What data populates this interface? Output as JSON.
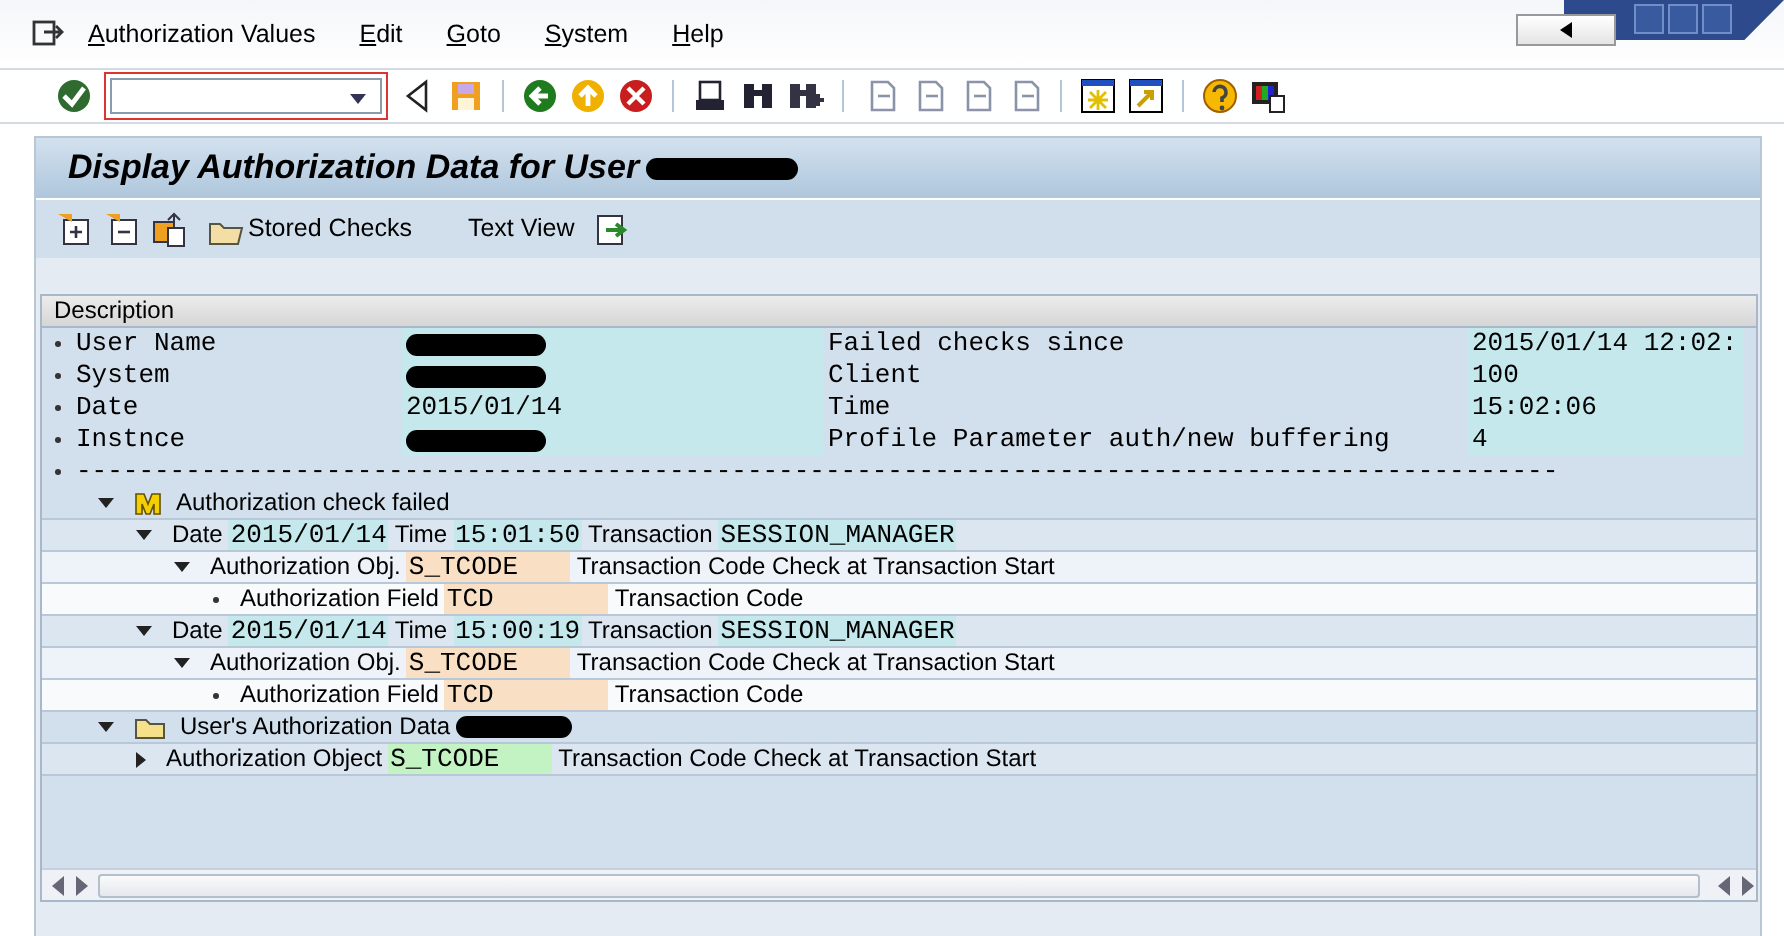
{
  "menu": [
    "Authorization Values",
    "Edit",
    "Goto",
    "System",
    "Help"
  ],
  "title": {
    "text": "Display Authorization Data for User",
    "redacted": true
  },
  "app_toolbar": [
    {
      "kind": "expand"
    },
    {
      "kind": "collapse"
    },
    {
      "kind": "export"
    },
    {
      "kind": "folder",
      "label": "Stored Checks"
    },
    {
      "kind": "text",
      "label": "Text View"
    },
    {
      "kind": "transfer"
    }
  ],
  "tree_header": "Description",
  "info_rows": [
    {
      "kind": "pair",
      "label": "User Name",
      "redacted": true,
      "label_2": "Failed checks since",
      "value_2": "2015/01/14 12:02:"
    },
    {
      "kind": "pair",
      "label": "System",
      "redacted": true,
      "label_2": "Client",
      "value_2": "100"
    },
    {
      "kind": "pair",
      "label": "Date",
      "redacted": false,
      "value": "2015/01/14",
      "label_2": "Time",
      "value_2": "15:02:06"
    },
    {
      "kind": "pair",
      "label": "Instnce",
      "redacted": true,
      "label_2": "Profile Parameter auth/new buffering",
      "value_2": "4"
    },
    {
      "kind": "rule",
      "text": "-----------------------------------------------------------------------------------------------"
    }
  ],
  "tree": [
    {
      "kind": "failed",
      "label": "Authorization check failed",
      "expanded": true,
      "children": [
        {
          "expanded": true,
          "segments": [
            {
              "kind": "label",
              "text": "Date"
            },
            {
              "kind": "value",
              "text": "2015/01/14",
              "color": "#c4e8ec"
            },
            {
              "kind": "label",
              "text": "Time"
            },
            {
              "kind": "value",
              "text": "15:01:50",
              "color": "#c4e8ec"
            },
            {
              "kind": "label",
              "text": "Transaction"
            },
            {
              "kind": "value",
              "text": "SESSION_MANAGER",
              "color": "#c4e8ec"
            }
          ],
          "children": [
            {
              "expanded": true,
              "segments": [
                {
                  "kind": "label",
                  "text": "Authorization Obj."
                },
                {
                  "kind": "field",
                  "text": "S_TCODE",
                  "color": "#f9e0c4"
                },
                {
                  "kind": "label",
                  "text": "Transaction Code Check at Transaction Start"
                }
              ],
              "children": [
                {
                  "segments": [
                    {
                      "kind": "label",
                      "text": "Authorization Field"
                    },
                    {
                      "kind": "field",
                      "text": "TCD",
                      "color": "#f9e0c4"
                    },
                    {
                      "kind": "label",
                      "text": "Transaction Code"
                    }
                  ]
                }
              ]
            }
          ]
        },
        {
          "expanded": true,
          "segments": [
            {
              "kind": "label",
              "text": "Date"
            },
            {
              "kind": "value",
              "text": "2015/01/14",
              "color": "#c4e8ec"
            },
            {
              "kind": "label",
              "text": "Time"
            },
            {
              "kind": "value",
              "text": "15:00:19",
              "color": "#c4e8ec"
            },
            {
              "kind": "label",
              "text": "Transaction"
            },
            {
              "kind": "value",
              "text": "SESSION_MANAGER",
              "color": "#c4e8ec"
            }
          ],
          "children": [
            {
              "expanded": true,
              "segments": [
                {
                  "kind": "label",
                  "text": "Authorization Obj."
                },
                {
                  "kind": "field",
                  "text": "S_TCODE",
                  "color": "#f9e0c4"
                },
                {
                  "kind": "label",
                  "text": "Transaction Code Check at Transaction Start"
                }
              ],
              "children": [
                {
                  "segments": [
                    {
                      "kind": "label",
                      "text": "Authorization Field"
                    },
                    {
                      "kind": "field",
                      "text": "TCD",
                      "color": "#f9e0c4"
                    },
                    {
                      "kind": "label",
                      "text": "Transaction Code"
                    }
                  ]
                }
              ]
            }
          ]
        }
      ]
    },
    {
      "kind": "user-data",
      "label": "User's Authorization Data",
      "redacted": true,
      "expanded": true,
      "children": [
        {
          "expanded": false,
          "segments": [
            {
              "kind": "label",
              "text": "Authorization Object"
            },
            {
              "kind": "field",
              "text": "S_TCODE",
              "color": "#c3f2c3"
            },
            {
              "kind": "label",
              "text": "Transaction Code Check at Transaction Start"
            }
          ]
        }
      ]
    }
  ]
}
